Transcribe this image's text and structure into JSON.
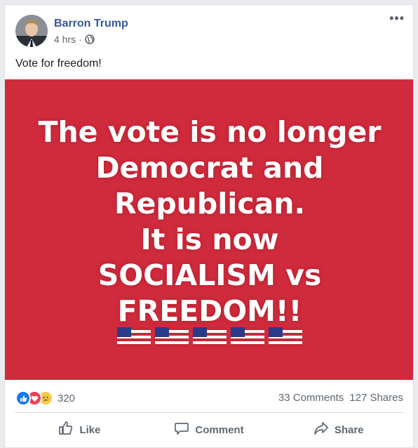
{
  "post": {
    "author": "Barron Trump",
    "time": "4 hrs",
    "separator": "·",
    "privacy_icon": "globe-icon",
    "more_icon": "more-options-icon",
    "more_label": "•••",
    "text": "Vote for freedom!"
  },
  "image": {
    "background_color": "#cf2b3d",
    "lines": [
      "The vote is no longer",
      "Democrat and",
      "Republican.",
      "It is now",
      "SOCIALISM vs",
      "FREEDOM!!"
    ],
    "flag_count": 5,
    "flag_icon": "us-flag-icon"
  },
  "stats": {
    "reaction_icons": [
      "like-reaction-icon",
      "love-reaction-icon",
      "sad-reaction-icon"
    ],
    "reaction_count": "320",
    "comments": "33 Comments",
    "shares": "127 Shares"
  },
  "actions": {
    "like": "Like",
    "comment": "Comment",
    "share": "Share"
  },
  "colors": {
    "author_link": "#385898",
    "like_blue": "#1877f2",
    "love_red": "#f33e58",
    "sad_yellow": "#f7c94b"
  }
}
